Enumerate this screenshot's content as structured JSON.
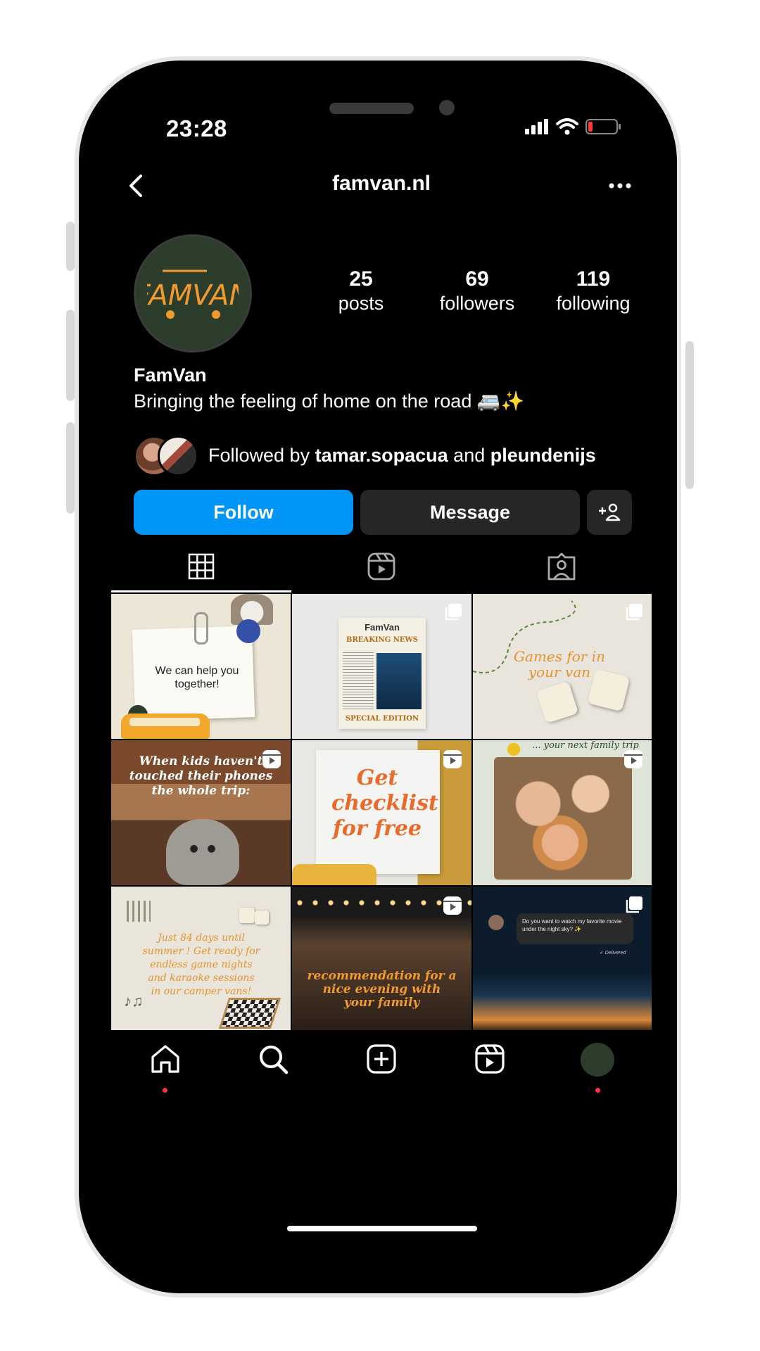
{
  "status_bar": {
    "time": "23:28"
  },
  "header": {
    "username": "famvan.nl"
  },
  "profile": {
    "logo_text": "FAMVAN",
    "stats": [
      {
        "value": "25",
        "label": "posts"
      },
      {
        "value": "69",
        "label": "followers"
      },
      {
        "value": "119",
        "label": "following"
      }
    ],
    "display_name": "FamVan",
    "bio": "Bringing the feeling of home on the road 🚐✨",
    "followed_by": {
      "prefix": "Followed by ",
      "user1": "tamar.sopacua",
      "conjunction": " and ",
      "user2": "pleundenijs"
    }
  },
  "actions": {
    "follow_label": "Follow",
    "message_label": "Message"
  },
  "posts": [
    {
      "text": "We can help you together!",
      "badge": "none"
    },
    {
      "title": "FamVan",
      "headline": "BREAKING NEWS",
      "footer": "SPECIAL EDITION",
      "badge": "multi"
    },
    {
      "text": "Games for in your van",
      "badge": "multi"
    },
    {
      "text": "When kids haven't touched their phones the whole trip:",
      "badge": "reel"
    },
    {
      "text": "Get checklist for free",
      "badge": "reel"
    },
    {
      "text": "... your next family trip",
      "badge": "reel"
    },
    {
      "text": "Just 84 days until summer ! Get ready for endless game nights and karaoke sessions in our camper vans!",
      "badge": "none"
    },
    {
      "text": "recommendation for a nice evening with your family",
      "badge": "reel"
    },
    {
      "message": "Do you want to watch my favorite movie under the night sky? ✨",
      "status": "✓ Delivered",
      "badge": "multi"
    }
  ],
  "colors": {
    "accent": "#0095f6",
    "button_dark": "#262626",
    "logo_orange": "#f29a2e",
    "logo_green": "#2d3d2b",
    "notification": "#ff3040"
  }
}
